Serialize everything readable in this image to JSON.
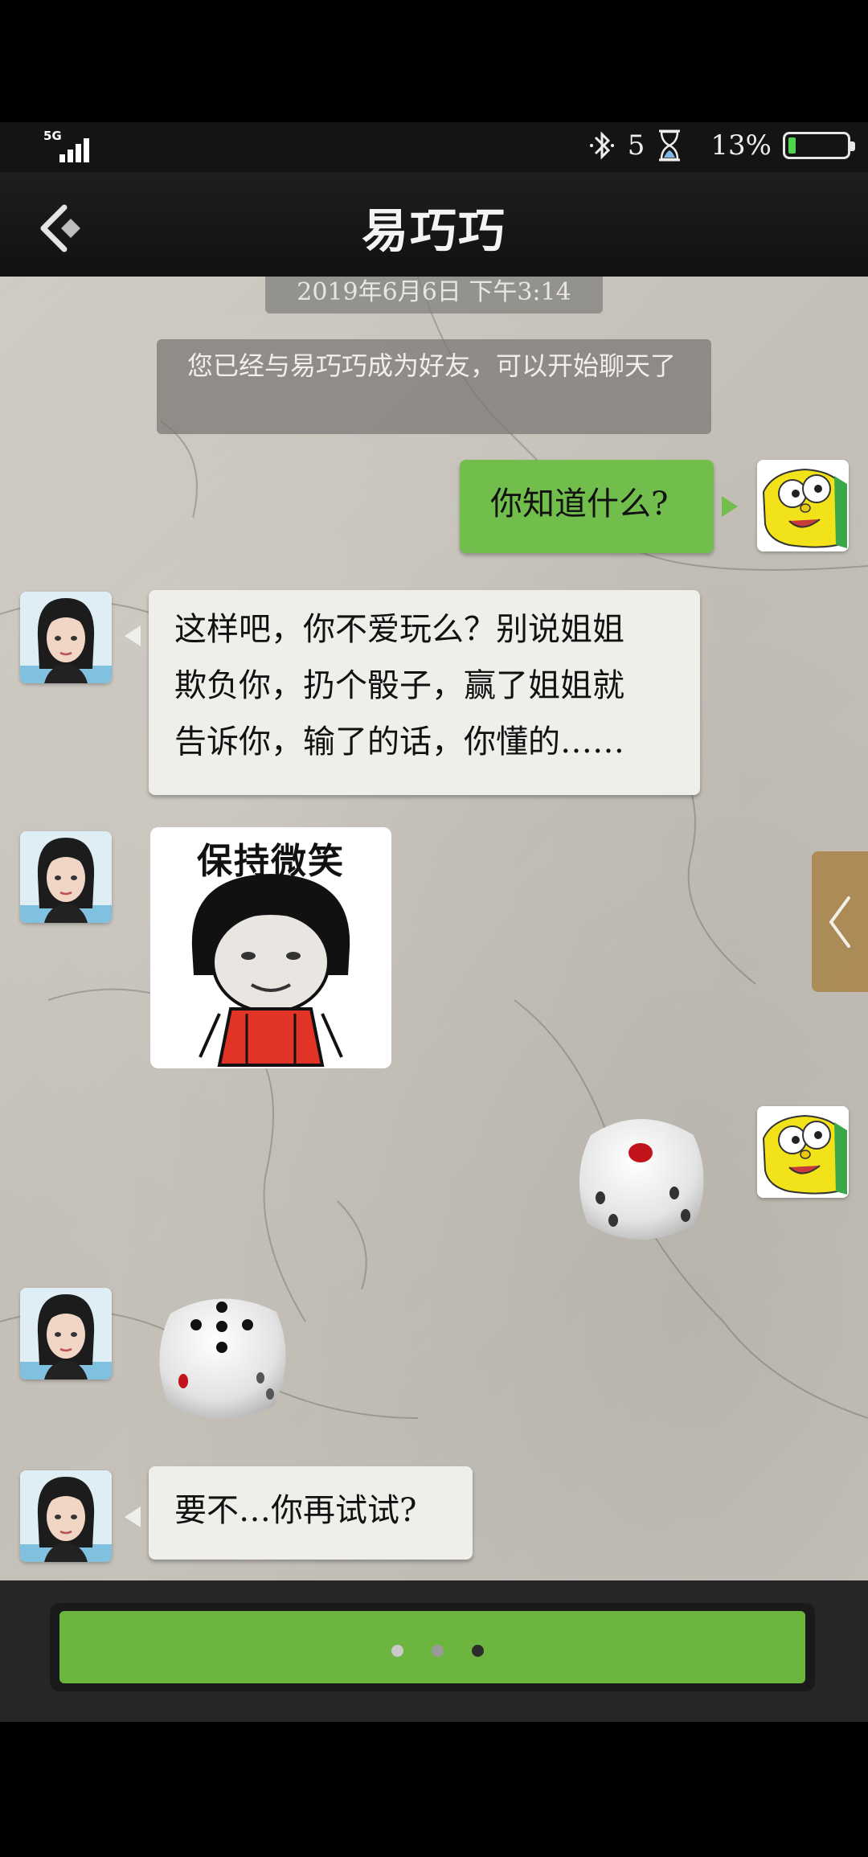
{
  "status_bar": {
    "network": "5G",
    "notification_count": "5",
    "battery_text": "13%",
    "battery_level": 0.13
  },
  "header": {
    "title": "易巧巧"
  },
  "chat": {
    "timestamp": "2019年6月6日 下午3:14",
    "system_message": "您已经与易巧巧成为好友，可以开始聊天了",
    "messages": [
      {
        "from": "me",
        "type": "text",
        "text": "你知道什么?"
      },
      {
        "from": "contact",
        "type": "text",
        "lines": [
          "这样吧，你不爱玩么？别说姐姐",
          "欺负你，扔个骰子，赢了姐姐就",
          "告诉你，输了的话，你懂的……"
        ]
      },
      {
        "from": "contact",
        "type": "sticker",
        "caption": "保持微笑"
      },
      {
        "from": "me",
        "type": "dice",
        "value": 1
      },
      {
        "from": "contact",
        "type": "dice",
        "value": 5
      },
      {
        "from": "contact",
        "type": "text",
        "text": "要不…你再试试?"
      }
    ]
  },
  "input_bar": {
    "dots": 3,
    "active_dot": 3
  },
  "colors": {
    "outgoing_bubble": "#72be4d",
    "incoming_bubble": "#eeeeeb",
    "input_green": "#6cb53e"
  }
}
